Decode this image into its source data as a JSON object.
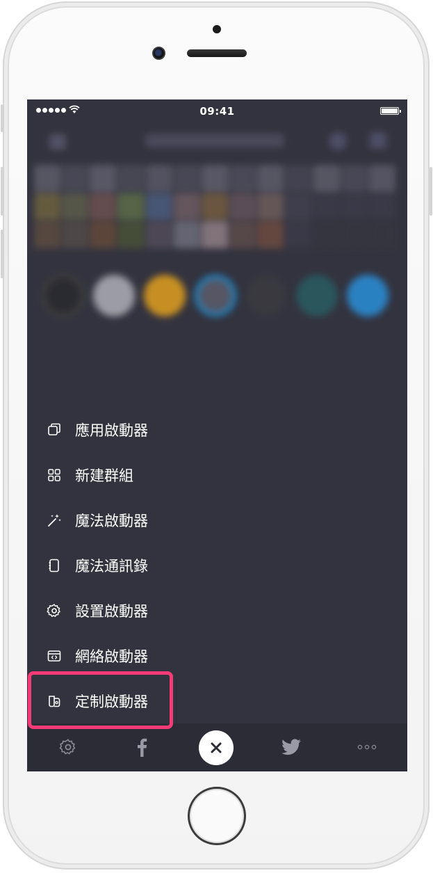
{
  "status_bar": {
    "time": "09:41"
  },
  "menu": {
    "items": [
      {
        "label": "應用啟動器",
        "icon": "app-launcher-icon"
      },
      {
        "label": "新建群組",
        "icon": "grid-icon"
      },
      {
        "label": "魔法啟動器",
        "icon": "magic-wand-icon"
      },
      {
        "label": "魔法通訊錄",
        "icon": "contacts-icon"
      },
      {
        "label": "設置啟動器",
        "icon": "gear-icon"
      },
      {
        "label": "網絡啟動器",
        "icon": "web-code-icon"
      },
      {
        "label": "定制啟動器",
        "icon": "custom-launcher-icon"
      }
    ]
  },
  "bottom_bar": {
    "items": [
      "settings-icon",
      "facebook-icon",
      "close-icon",
      "twitter-icon",
      "more-icon"
    ]
  },
  "colors": {
    "screen_bg": "#33333f",
    "highlight": "#f53a78",
    "bottom_bar_bg": "#2c2c36"
  }
}
